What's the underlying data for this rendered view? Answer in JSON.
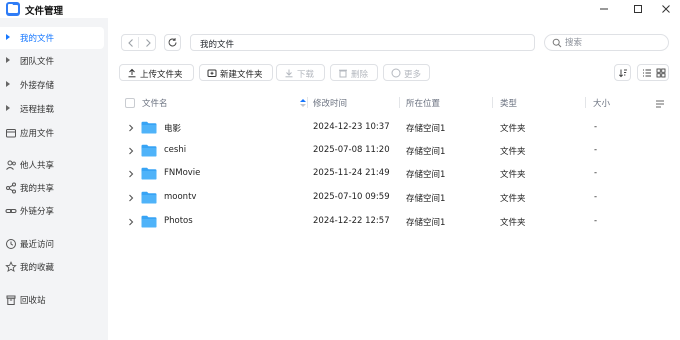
{
  "app": {
    "title": "文件管理",
    "icon": "folder-app-icon"
  },
  "window_controls": [
    "minimize-icon",
    "maximize-icon",
    "close-icon"
  ],
  "sidebar": {
    "items": [
      {
        "label": "我的文件",
        "icon": "caret-right-icon",
        "active": true
      },
      {
        "label": "团队文件",
        "icon": "caret-right-icon"
      },
      {
        "label": "外接存储",
        "icon": "caret-right-icon"
      },
      {
        "label": "远程挂载",
        "icon": "caret-right-icon"
      },
      {
        "label": "应用文件",
        "icon": "app-folder-icon"
      },
      {
        "label": "他人共享",
        "icon": "users-icon"
      },
      {
        "label": "我的共享",
        "icon": "share-icon"
      },
      {
        "label": "外链分享",
        "icon": "link-icon"
      },
      {
        "label": "最近访问",
        "icon": "clock-icon"
      },
      {
        "label": "我的收藏",
        "icon": "star-icon"
      },
      {
        "label": "回收站",
        "icon": "trash-icon"
      }
    ]
  },
  "path": {
    "current": "我的文件"
  },
  "search": {
    "placeholder": "搜索"
  },
  "toolbar": {
    "upload": "上传文件夹",
    "new_folder": "新建文件夹",
    "download": "下载",
    "delete": "删除",
    "more": "更多"
  },
  "table": {
    "columns": {
      "name": "文件名",
      "modified": "修改时间",
      "location": "所在位置",
      "type": "类型",
      "size": "大小"
    },
    "rows": [
      {
        "name": "电影",
        "modified": "2024-12-23 10:37",
        "location": "存储空间1",
        "type": "文件夹",
        "size": "-"
      },
      {
        "name": "ceshi",
        "modified": "2025-07-08 11:20",
        "location": "存储空间1",
        "type": "文件夹",
        "size": "-"
      },
      {
        "name": "FNMovie",
        "modified": "2025-11-24 21:49",
        "location": "存储空间1",
        "type": "文件夹",
        "size": "-"
      },
      {
        "name": "moontv",
        "modified": "2025-07-10 09:59",
        "location": "存储空间1",
        "type": "文件夹",
        "size": "-"
      },
      {
        "name": "Photos",
        "modified": "2024-12-22 12:57",
        "location": "存储空间1",
        "type": "文件夹",
        "size": "-"
      }
    ]
  },
  "colors": {
    "accent": "#1677ff",
    "folder": "#38a4f5",
    "sidebar_bg": "#f3f4f6"
  }
}
